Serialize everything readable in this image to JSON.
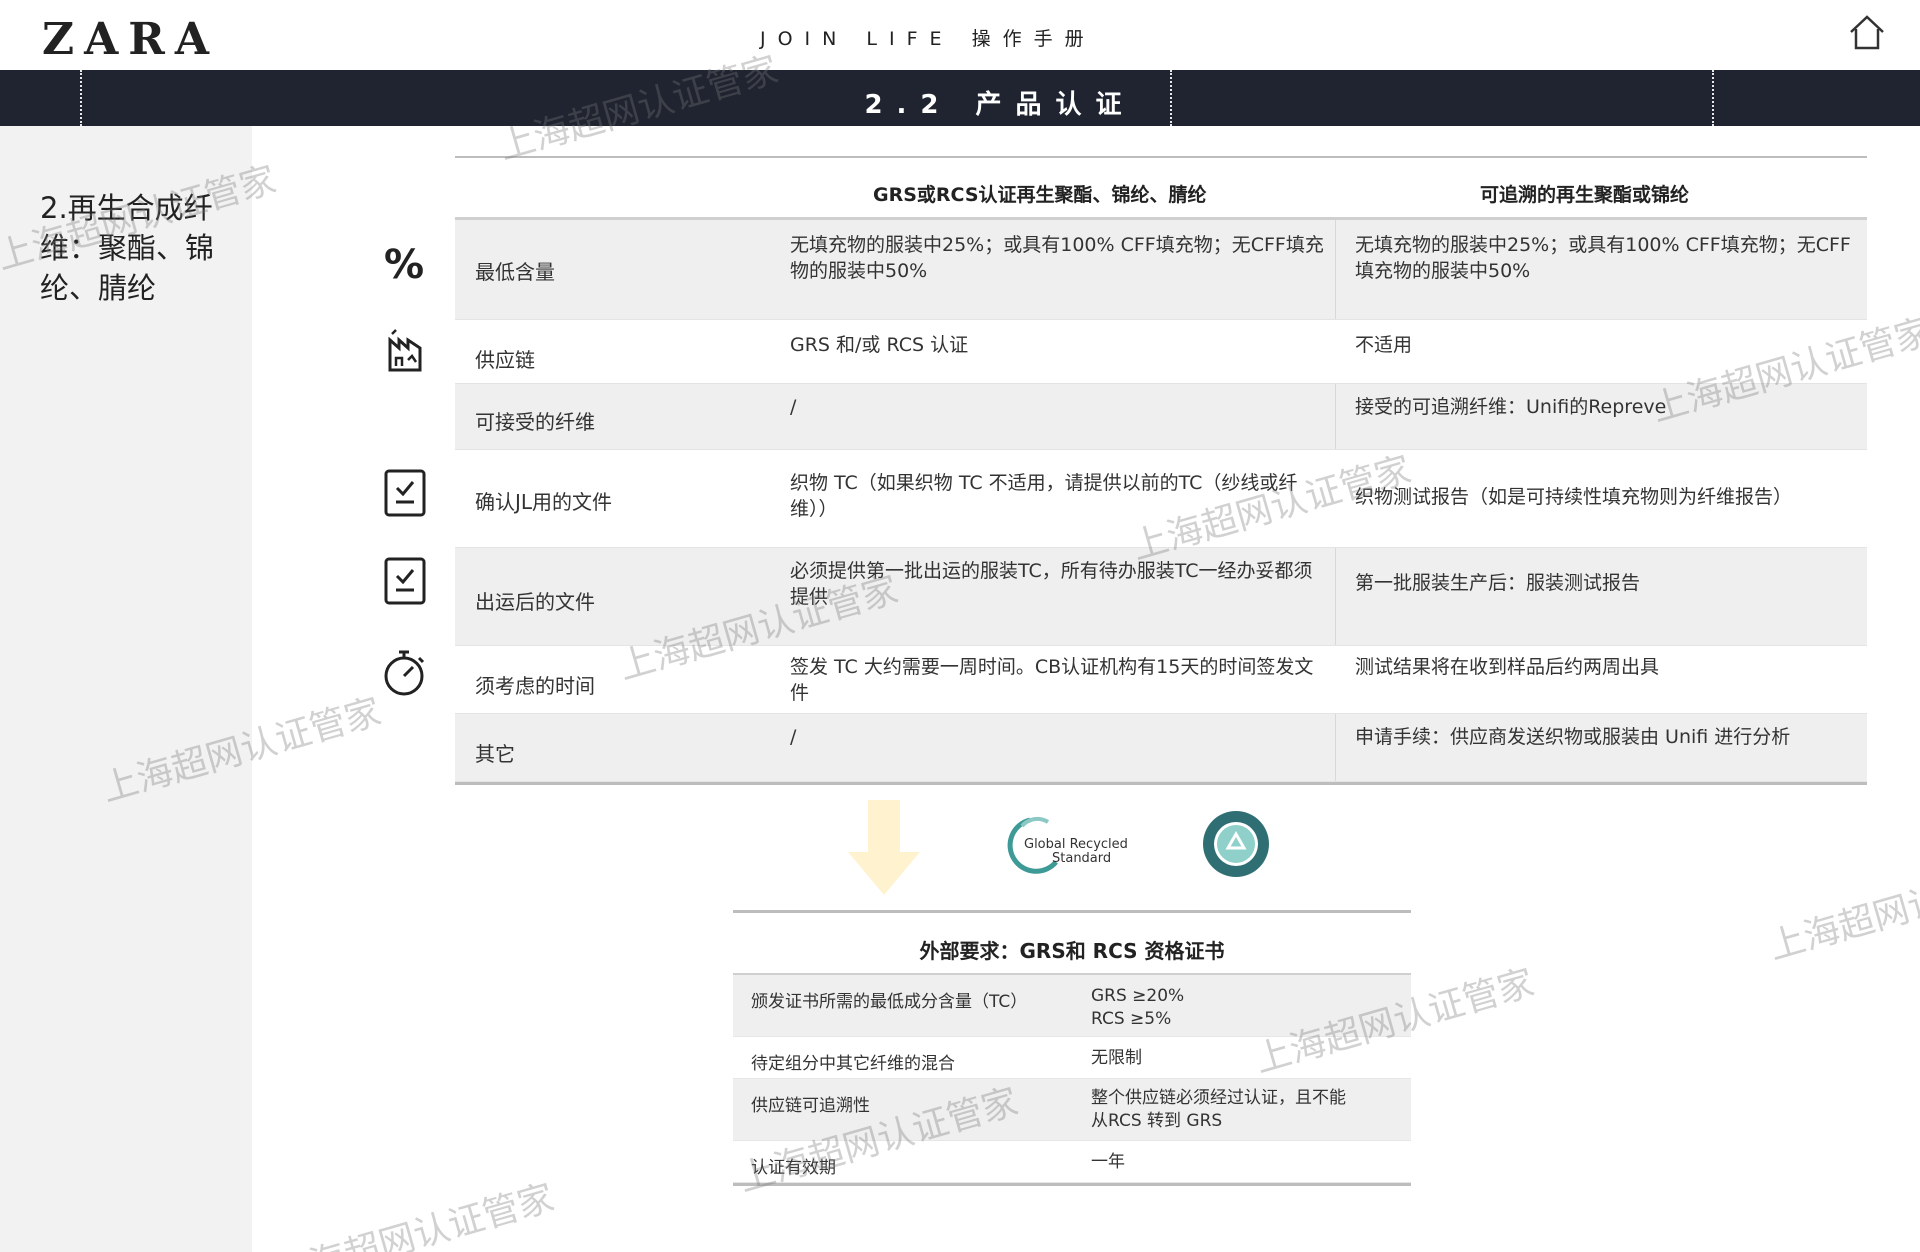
{
  "header": {
    "logo": "ZARA",
    "brand_title": "JOIN LIFE 操作手册",
    "section_title": "2.2 产品认证"
  },
  "sidebar": {
    "title": "2.再生合成纤维：聚酯、锦纶、腈纶"
  },
  "table": {
    "columns": [
      "GRS或RCS认证再生聚酯、锦纶、腈纶",
      "可追溯的再生聚酯或锦纶"
    ],
    "rows": [
      {
        "icon": "percent-icon",
        "label": "最低含量",
        "col1": "无填充物的服装中25%；或具有100% CFF填充物；无CFF填充物的服装中50%",
        "col2": "无填充物的服装中25%；或具有100% CFF填充物；无CFF填充物的服装中50%"
      },
      {
        "icon": "factory-icon",
        "label": "供应链",
        "col1": "GRS 和/或 RCS 认证",
        "col2": "不适用"
      },
      {
        "icon": "",
        "label": "可接受的纤维",
        "col1": "/",
        "col2": "接受的可追溯纤维：Unifi的Repreve"
      },
      {
        "icon": "checklist-icon",
        "label": "确认JL用的文件",
        "col1": "织物 TC（如果织物 TC 不适用，请提供以前的TC（纱线或纤维））",
        "col2": "织物测试报告（如是可持续性填充物则为纤维报告）"
      },
      {
        "icon": "checklist-icon",
        "label": "出运后的文件",
        "col1": "必须提供第一批出运的服装TC，所有待办服装TC一经办妥都须提供",
        "col2": "第一批服装生产后：服装测试报告"
      },
      {
        "icon": "stopwatch-icon",
        "label": "须考虑的时间",
        "col1": "签发 TC 大约需要一周时间。CB认证机构有15天的时间签发文件",
        "col2": "测试结果将在收到样品后约两周出具"
      },
      {
        "icon": "",
        "label": "其它",
        "col1": "/",
        "col2": "申请手续：供应商发送织物或服装由 Unifi 进行分析"
      }
    ]
  },
  "logos": {
    "grs_text_1": "Global Recycled",
    "grs_text_2": "Standard"
  },
  "external": {
    "title": "外部要求：GRS和 RCS 资格证书",
    "rows": [
      {
        "label": "颁发证书所需的最低成分含量（TC）",
        "value_line1": "GRS ≥20%",
        "value_line2": "RCS ≥5%"
      },
      {
        "label": "待定组分中其它纤维的混合",
        "value_line1": "无限制",
        "value_line2": ""
      },
      {
        "label": "供应链可追溯性",
        "value_line1": "整个供应链必须经过认证，且不能",
        "value_line2": "从RCS 转到 GRS"
      },
      {
        "label": "认证有效期",
        "value_line1": "一年",
        "value_line2": ""
      }
    ]
  },
  "watermark": "上海超网认证管家",
  "colors": {
    "band": "#1f2430",
    "sidebar": "#f2f2f2",
    "row_shade": "#efefef",
    "arrow": "#fff3cf"
  }
}
